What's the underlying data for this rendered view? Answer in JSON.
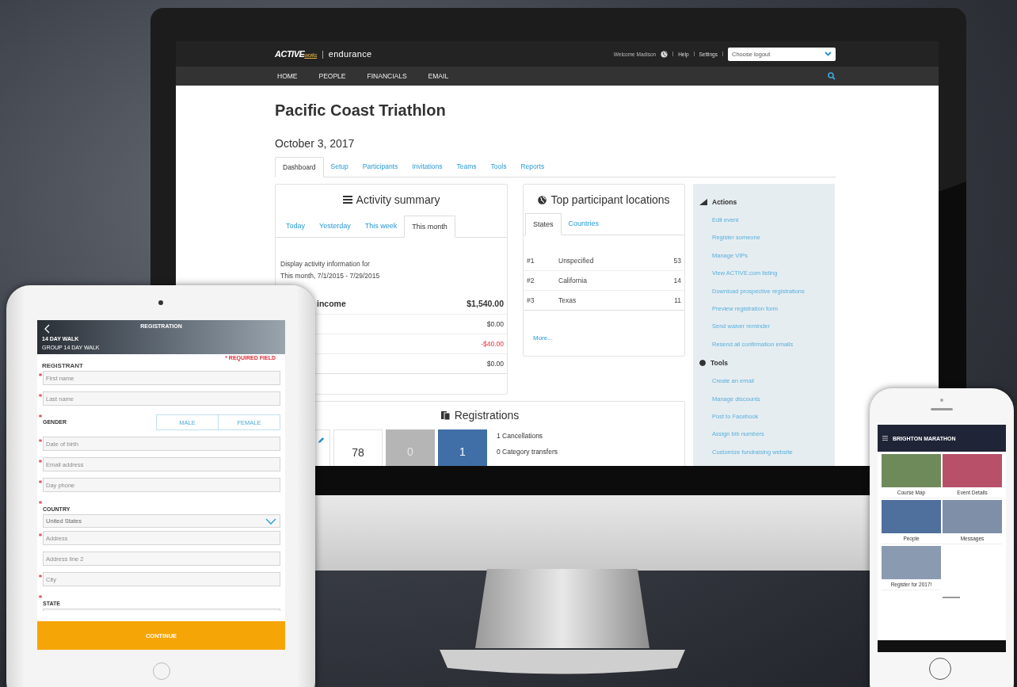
{
  "desktop": {
    "brand": {
      "name": "ACTIVE",
      "suffix": "works",
      "separator": "|",
      "product": "endurance"
    },
    "header": {
      "welcome": "Welcome Madison",
      "links": [
        "Help",
        "Settings"
      ],
      "logout_select": {
        "value": "Choose logout"
      }
    },
    "nav": [
      "HOME",
      "PEOPLE",
      "FINANCIALS",
      "EMAIL"
    ],
    "title": "Pacific Coast Triathlon",
    "date": "October 3, 2017",
    "tabs": [
      {
        "label": "Dashboard",
        "selected": true
      },
      {
        "label": "Setup",
        "selected": false
      },
      {
        "label": "Participants",
        "selected": false
      },
      {
        "label": "Invitations",
        "selected": false
      },
      {
        "label": "Teams",
        "selected": false
      },
      {
        "label": "Tools",
        "selected": false
      },
      {
        "label": "Reports",
        "selected": false
      }
    ],
    "activity_summary": {
      "title": "Activity summary",
      "tabs": [
        {
          "label": "Today",
          "selected": false
        },
        {
          "label": "Yesterday",
          "selected": false
        },
        {
          "label": "This week",
          "selected": false
        },
        {
          "label": "This month",
          "selected": true
        }
      ],
      "description": [
        "Display activity information for",
        "This month, 7/1/2015 - 7/29/2015"
      ],
      "rows": [
        {
          "label": "income",
          "amount": "$1,540.00",
          "kind": "total",
          "negative": false
        },
        {
          "amount": "$0.00",
          "kind": "line",
          "negative": false
        },
        {
          "amount": "-$40.00",
          "kind": "line",
          "negative": true
        },
        {
          "amount": "$0.00",
          "kind": "line",
          "negative": false
        }
      ]
    },
    "locations": {
      "title": "Top participant locations",
      "tabs": [
        {
          "label": "States",
          "selected": true
        },
        {
          "label": "Countries",
          "selected": false
        }
      ],
      "rows": [
        {
          "rank": "#1",
          "name": "Unspecified",
          "count": "53"
        },
        {
          "rank": "#2",
          "name": "California",
          "count": "14"
        },
        {
          "rank": "#3",
          "name": "Texas",
          "count": "11"
        }
      ],
      "more": "More..."
    },
    "sidebar": {
      "sections": [
        {
          "title": "Actions",
          "kind": "actions",
          "links": [
            "Edit event",
            "Register someone",
            "Manage VIPs",
            "View ACTIVE.com listing",
            "Download prospective registrations",
            "Preview registration form",
            "Send waiver reminder",
            "Resend all confirmation emails"
          ]
        },
        {
          "title": "Tools",
          "kind": "tools",
          "links": [
            "Create an email",
            "Manage discounts",
            "Post to Facebook",
            "Assign bib numbers",
            "Customize fundraising website"
          ]
        }
      ]
    },
    "registrations": {
      "title": "Registrations",
      "tiles": [
        {
          "kind": "edit"
        },
        {
          "kind": "plain",
          "value": "78"
        },
        {
          "kind": "grey",
          "value": "0"
        },
        {
          "kind": "blue",
          "value": "1"
        }
      ],
      "stats": [
        "1 Cancellations",
        "0 Category transfers"
      ]
    }
  },
  "tablet": {
    "header": {
      "title": "REGISTRATION",
      "event": "14 DAY WALK",
      "group": "GROUP 14 DAY WALK"
    },
    "required_note": "* REQUIRED FIELD",
    "section": "REGISTRANT",
    "fields": [
      {
        "kind": "input",
        "placeholder": "First name",
        "required": true
      },
      {
        "kind": "input",
        "placeholder": "Last name",
        "required": true
      },
      {
        "kind": "toggle",
        "label": "GENDER",
        "required": true,
        "options": [
          {
            "label": "MALE",
            "selected": false
          },
          {
            "label": "FEMALE",
            "selected": false
          }
        ]
      },
      {
        "kind": "input",
        "placeholder": "Date of birth",
        "required": true
      },
      {
        "kind": "input",
        "placeholder": "Email address",
        "required": true
      },
      {
        "kind": "input",
        "placeholder": "Day phone",
        "required": true
      },
      {
        "kind": "select",
        "label": "COUNTRY",
        "required": true,
        "value": "United States"
      },
      {
        "kind": "input",
        "placeholder": "Address",
        "required": true
      },
      {
        "kind": "input",
        "placeholder": "Address line 2",
        "required": false
      },
      {
        "kind": "input",
        "placeholder": "City",
        "required": true
      },
      {
        "kind": "label",
        "label": "STATE",
        "required": true
      }
    ],
    "continue": "CONTINUE"
  },
  "phone": {
    "header": {
      "title": "BRIGHTON MARATHON"
    },
    "tiles": [
      {
        "label": "Course Map"
      },
      {
        "label": "Event Details"
      },
      {
        "label": "People"
      },
      {
        "label": "Messages"
      },
      {
        "label": "Register for 2017!"
      }
    ]
  }
}
